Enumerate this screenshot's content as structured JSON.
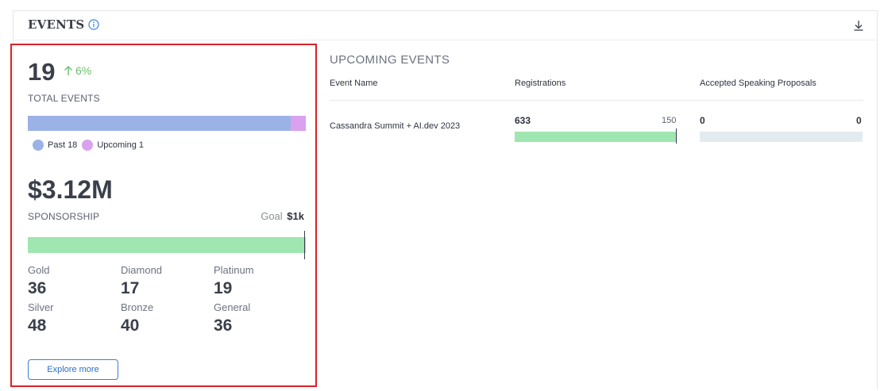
{
  "card": {
    "title": "EVENTS",
    "info_icon": "info-circle-icon",
    "download_icon": "download-icon"
  },
  "summary": {
    "total_events": "19",
    "trend_text": "6%",
    "trend_icon": "arrow-up-icon",
    "total_label": "TOTAL EVENTS",
    "split": {
      "past_fraction": 0.947,
      "upcoming_fraction": 0.053
    },
    "legend": [
      {
        "label": "Past 18",
        "color": "#9bb2e7"
      },
      {
        "label": "Upcoming 1",
        "color": "#d9a1ee"
      }
    ],
    "sponsorship_value": "$3.12M",
    "sponsorship_label": "SPONSORSHIP",
    "goal_label": "Goal",
    "goal_value": "$1k",
    "sponsorship_progress": 1.0,
    "tiers": [
      {
        "name": "Gold",
        "value": "36"
      },
      {
        "name": "Diamond",
        "value": "17"
      },
      {
        "name": "Platinum",
        "value": "19"
      },
      {
        "name": "Silver",
        "value": "48"
      },
      {
        "name": "Bronze",
        "value": "40"
      },
      {
        "name": "General",
        "value": "36"
      }
    ],
    "explore_button": "Explore more"
  },
  "upcoming": {
    "title": "UPCOMING EVENTS",
    "columns": [
      "Event Name",
      "Registrations",
      "Accepted Speaking Proposals"
    ],
    "rows": [
      {
        "event_name": "Cassandra Summit + AI.dev 2023",
        "registrations": "633",
        "registrations_goal": "150",
        "registrations_progress": 1.0,
        "accepted": "0",
        "accepted_goal": "0",
        "accepted_progress": 0
      }
    ]
  },
  "colors": {
    "highlight_border": "#d9222a",
    "progress_green": "#9fe6b0",
    "trend_green": "#6cbf6b",
    "accent_blue": "#3b7fd6"
  }
}
